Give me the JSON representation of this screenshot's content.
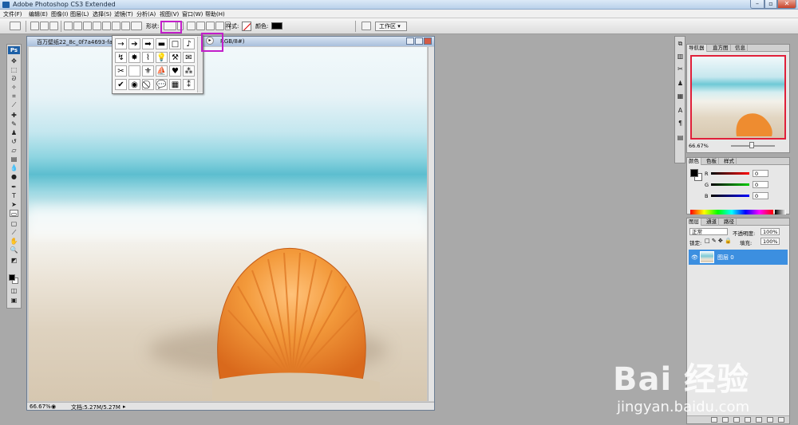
{
  "window": {
    "title": "Adobe Photoshop CS3 Extended"
  },
  "menu": [
    "文件(F)",
    "编辑(E)",
    "图像(I)",
    "图层(L)",
    "选择(S)",
    "滤镜(T)",
    "分析(A)",
    "视图(V)",
    "窗口(W)",
    "帮助(H)"
  ],
  "options": {
    "shape_label": "形状:",
    "style_label": "样式:",
    "color_label": "颜色:",
    "color_value": "#000000",
    "workspace_label": "工作区 ▾"
  },
  "document": {
    "title": "百万壁纸22_8c_0f7a4693-fa8c-4",
    "title_suffix": "RGB/8#)",
    "zoom": "66.67%",
    "doc_size": "文档:5.27M/5.27M"
  },
  "shape_popup": {
    "shapes": [
      "→",
      "➔",
      "➡",
      "▬",
      "□",
      "♪",
      "↯",
      "✸",
      "⌇",
      "💡",
      "⚒",
      "✉",
      "✂",
      "",
      "⚜",
      "⛵",
      "♥",
      "⁂",
      "✔",
      "◉",
      "⃠",
      "💬",
      "▦",
      "⁑"
    ]
  },
  "navigator": {
    "tabs": [
      "导航器",
      "直方图",
      "信息"
    ],
    "zoom": "66.67%"
  },
  "color_panel": {
    "tabs": [
      "颜色",
      "色板",
      "样式"
    ],
    "r_label": "R",
    "g_label": "G",
    "b_label": "B",
    "r": "0",
    "g": "0",
    "b": "0"
  },
  "layers": {
    "tabs": [
      "图层",
      "通道",
      "路径"
    ],
    "blend_mode": "正常",
    "opacity_label": "不透明度:",
    "opacity": "100%",
    "lock_label": "锁定:",
    "fill_label": "填充:",
    "fill": "100%",
    "items": [
      {
        "name": "图层 0"
      }
    ]
  },
  "watermark": {
    "logo": "Bai 经验",
    "url": "jingyan.baidu.com"
  },
  "colors": {
    "highlight": "#c21ec9",
    "layer_selected": "#3c8fe0"
  }
}
